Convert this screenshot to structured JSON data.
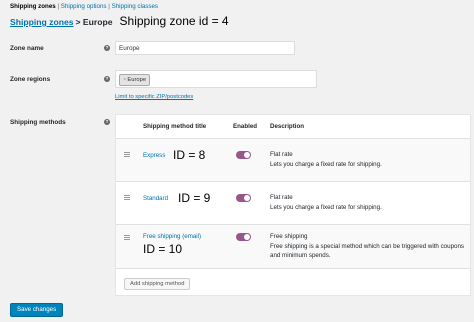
{
  "subnav": {
    "current": "Shipping zones",
    "separator": " | ",
    "items": [
      "Shipping options",
      "Shipping classes"
    ]
  },
  "header": {
    "crumb_link": "Shipping zones",
    "crumb_current": "> Europe",
    "zone_id_label": "Shipping zone id = 4"
  },
  "form": {
    "zone_name_label": "Zone name",
    "zone_name_value": "Europe",
    "zone_regions_label": "Zone regions",
    "region_chip": "Europe",
    "region_chip_remove": "×",
    "limit_link": "Limit to specific ZIP/postcodes",
    "shipping_methods_label": "Shipping methods",
    "help_glyph": "?"
  },
  "methods_table": {
    "headers": {
      "title": "Shipping method title",
      "enabled": "Enabled",
      "description": "Description"
    },
    "rows": [
      {
        "title": "Express",
        "id_label": "ID = 8",
        "enabled": true,
        "desc_title": "Flat rate",
        "desc_body": "Lets you charge a fixed rate for shipping."
      },
      {
        "title": "Standard",
        "id_label": "ID = 9",
        "enabled": true,
        "desc_title": "Flat rate",
        "desc_body": "Lets you charge a fixed rate for shipping."
      },
      {
        "title": "Free shipping (email)",
        "id_label": "ID = 10",
        "enabled": true,
        "desc_title": "Free shipping",
        "desc_body": "Free shipping is a special method which can be triggered with coupons and minimum spends."
      }
    ],
    "add_button": "Add shipping method"
  },
  "footer": {
    "save_button": "Save changes"
  },
  "colors": {
    "link": "#0073aa",
    "toggle_on": "#96588a",
    "primary_button": "#0085ba",
    "background": "#f1f1f1"
  },
  "icons": {
    "help": "help-icon",
    "drag": "drag-handle-icon",
    "toggle": "toggle-icon"
  }
}
